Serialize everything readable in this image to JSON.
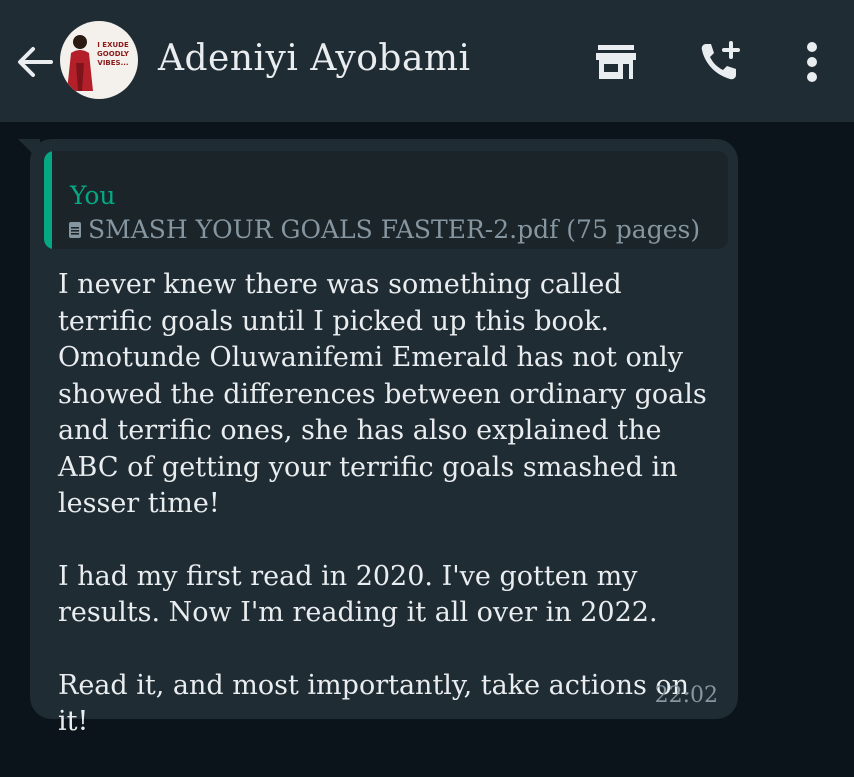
{
  "header": {
    "contact_name": "Adeniyi Ayobami",
    "avatar_caption": "I EXUDE GOODLY VIBES...",
    "icons": [
      "back-arrow-icon",
      "shop-icon",
      "add-call-icon",
      "more-vert-icon"
    ]
  },
  "message": {
    "quoted": {
      "sender": "You",
      "document": "SMASH YOUR GOALS FASTER-2.pdf (75 pages)"
    },
    "paragraphs": [
      "I never knew there was something called terrific goals until I picked up this book. Omotunde Oluwanifemi Emerald has not only showed the differences between ordinary goals and terrific ones, she has also explained the ABC of getting your terrific goals smashed in lesser time!",
      "I had my first read in 2020. I've gotten my results. Now I'm reading it all over in 2022.",
      "Read it, and most importantly, take actions on it!"
    ],
    "time": "22:02"
  },
  "colors": {
    "background": "#0b141a",
    "header": "#202c33",
    "bubble": "#202c33",
    "accent": "#06a884",
    "text": "#e9edef",
    "muted": "#8696a0"
  }
}
